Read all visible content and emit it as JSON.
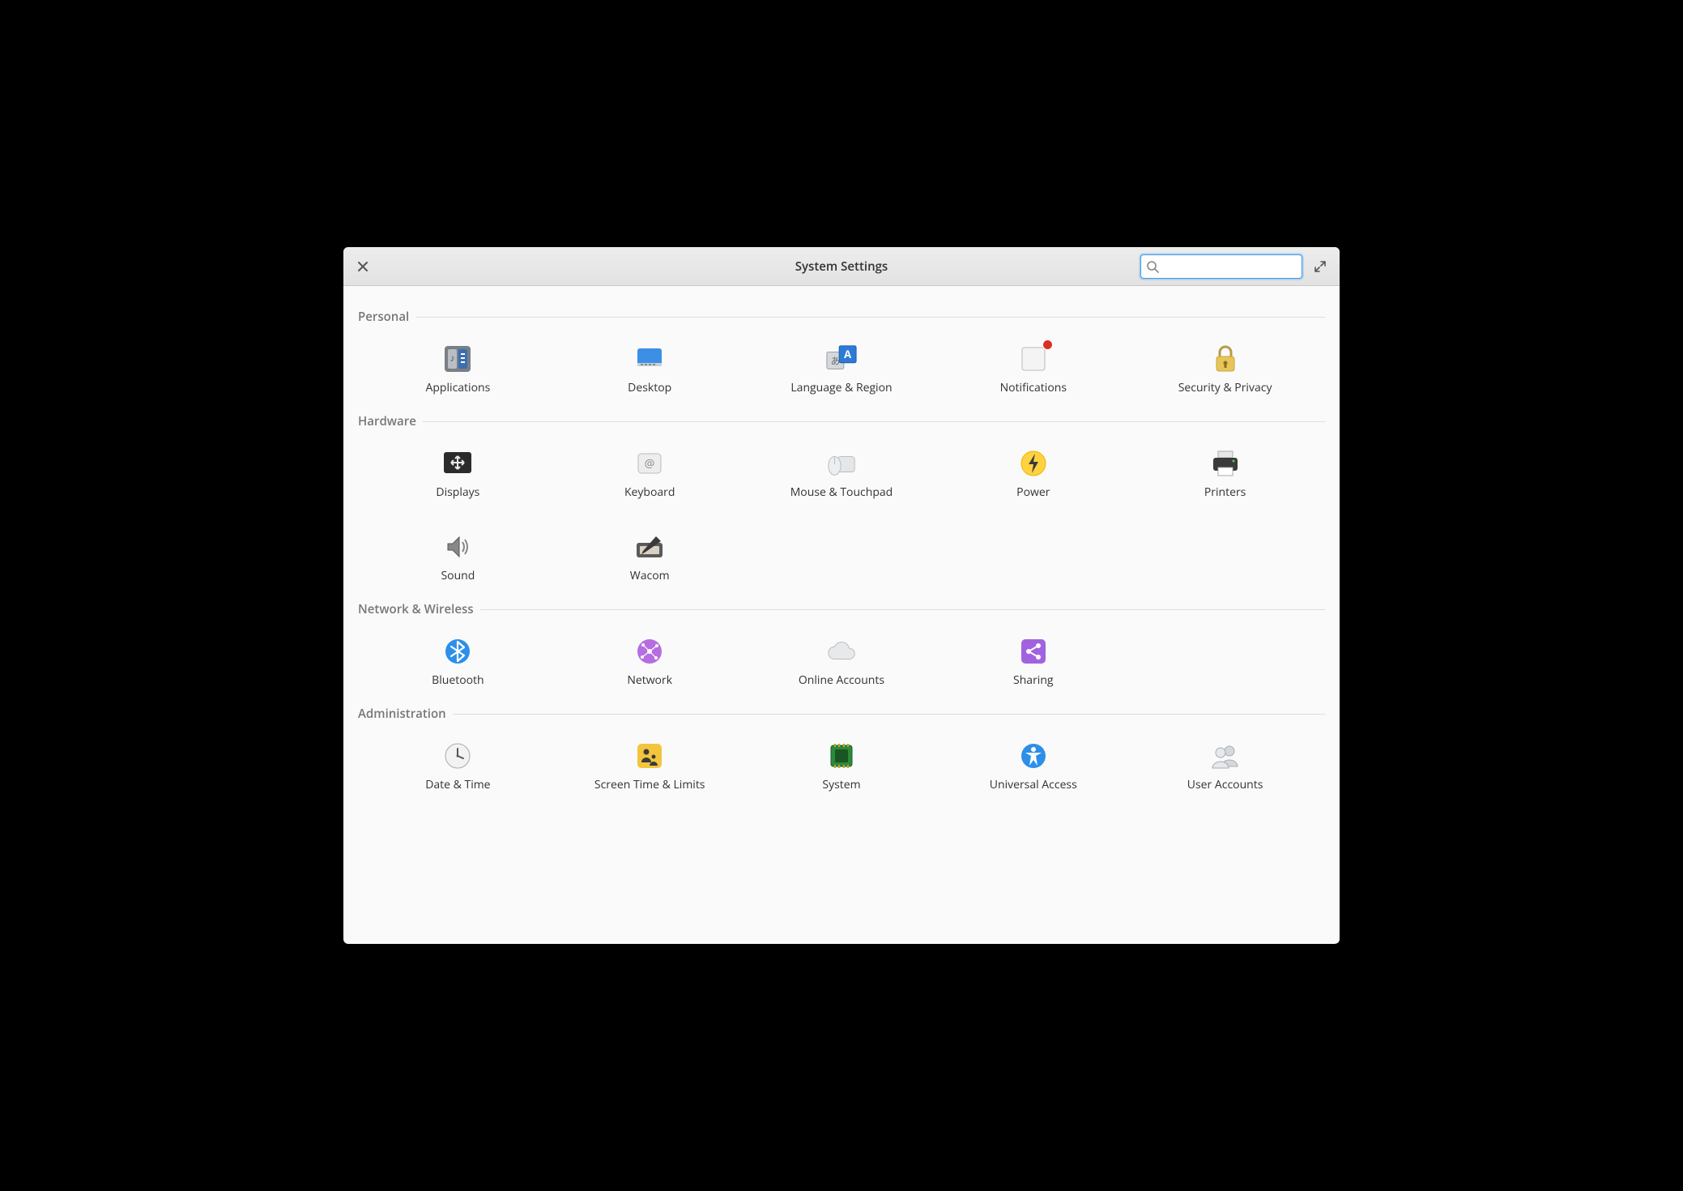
{
  "window": {
    "title": "System Settings",
    "search_placeholder": ""
  },
  "sections": {
    "personal": {
      "label": "Personal",
      "items": {
        "applications": "Applications",
        "desktop": "Desktop",
        "language_region": "Language & Region",
        "notifications": "Notifications",
        "security_privacy": "Security & Privacy"
      }
    },
    "hardware": {
      "label": "Hardware",
      "items": {
        "displays": "Displays",
        "keyboard": "Keyboard",
        "mouse_touchpad": "Mouse & Touchpad",
        "power": "Power",
        "printers": "Printers",
        "sound": "Sound",
        "wacom": "Wacom"
      }
    },
    "network_wireless": {
      "label": "Network & Wireless",
      "items": {
        "bluetooth": "Bluetooth",
        "network": "Network",
        "online_accounts": "Online Accounts",
        "sharing": "Sharing"
      }
    },
    "administration": {
      "label": "Administration",
      "items": {
        "date_time": "Date & Time",
        "screen_time": "Screen Time & Limits",
        "system": "System",
        "universal_access": "Universal Access",
        "user_accounts": "User Accounts"
      }
    }
  },
  "notifications_badge": true
}
